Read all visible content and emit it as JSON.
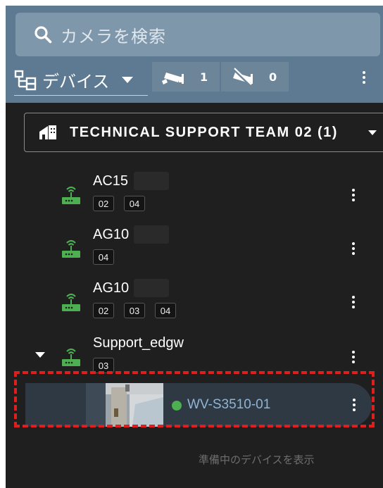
{
  "search": {
    "placeholder": "カメラを検索",
    "icon": "search-icon"
  },
  "toolbar": {
    "view_label": "デバイス",
    "view_icon": "device-tree-icon",
    "online_count": "1",
    "offline_count": "0"
  },
  "team": {
    "label": "TECHNICAL SUPPORT TEAM 02 (1)",
    "icon": "building-icon"
  },
  "gateways": [
    {
      "name": "AC15",
      "badges": [
        "02",
        "04"
      ],
      "redacted": true,
      "expanded": false
    },
    {
      "name": "AG10",
      "badges": [
        "04"
      ],
      "redacted": true,
      "expanded": false
    },
    {
      "name": "AG10",
      "badges": [
        "02",
        "03",
        "04"
      ],
      "redacted": true,
      "expanded": false
    },
    {
      "name": "Support_edgw",
      "badges": [
        "03"
      ],
      "redacted": false,
      "expanded": true
    }
  ],
  "camera": {
    "name": "WV-S3510-01",
    "status_color": "#4caf50",
    "icon": "camera-thumbnail"
  },
  "footer": {
    "show_pending_label": "準備中のデバイスを表示"
  },
  "colors": {
    "header_bg": "#5d7a92",
    "panel_bg": "#1f1f1f",
    "gateway_icon": "#4caf50",
    "camera_name": "#8fb5d6",
    "highlight": "#e01e1e"
  }
}
